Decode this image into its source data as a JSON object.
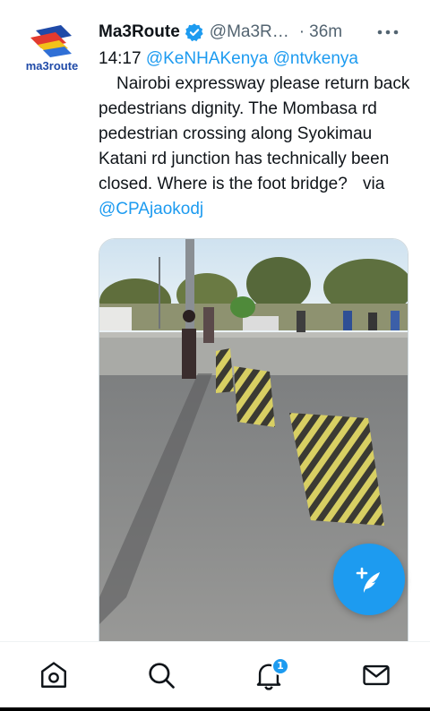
{
  "tweet": {
    "author_name": "Ma3Route",
    "author_handle": "@Ma3Route",
    "separator": "·",
    "time_ago": "36m",
    "avatar_logo_text": "ma3route",
    "text_time": "14:17",
    "mention_1": "@KeNHAKenya",
    "mention_2": "@ntvkenya",
    "text_main": "Nairobi expressway please return back pedestrians dignity. The Mombasa rd pedestrian crossing along Syokimau Katani rd junction has technically been closed. Where is the foot bridge?",
    "via_label": "via",
    "mention_3": "@CPAjaokodj"
  },
  "nav": {
    "notification_count": "1",
    "items": [
      "home-icon",
      "search-icon",
      "bell-icon",
      "mail-icon"
    ]
  },
  "colors": {
    "accent": "#1d9bf0",
    "text": "#0f1419",
    "secondary": "#536471"
  }
}
